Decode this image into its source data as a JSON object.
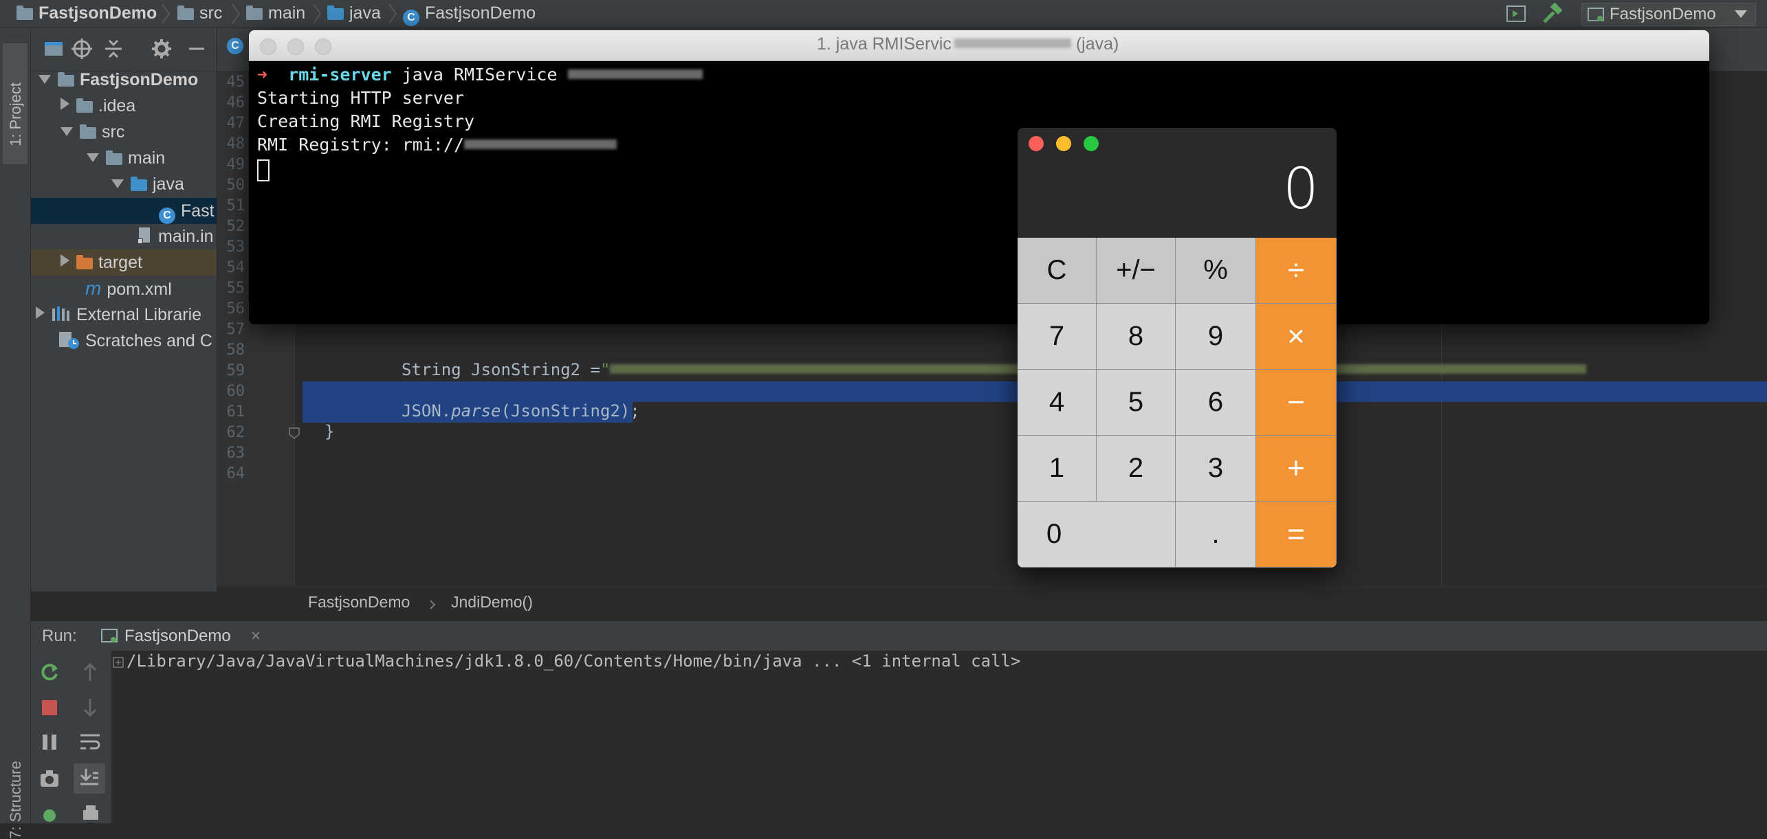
{
  "breadcrumbs": [
    "FastjsonDemo",
    "src",
    "main",
    "java",
    "FastjsonDemo"
  ],
  "run_config": "FastjsonDemo",
  "tool_windows": {
    "project": "1: Project",
    "structure": "7: Structure"
  },
  "project_tree": {
    "root": "FastjsonDemo",
    "idea": ".idea",
    "src": "src",
    "main": "main",
    "java": "java",
    "class_file": "Fast",
    "main_iml": "main.in",
    "target": "target",
    "pom": "pom.xml",
    "pom_icon": "m",
    "external": "External Librarie",
    "scratches": "Scratches and C"
  },
  "editor": {
    "line_numbers": [
      "45",
      "46",
      "47",
      "48",
      "49",
      "50",
      "51",
      "52",
      "53",
      "54",
      "55",
      "56",
      "57",
      "58",
      "59",
      "60",
      "61",
      "62",
      "63",
      "64"
    ],
    "code_59": "String JsonString2 =",
    "code_59_quote": "\"",
    "code_61_obj": "JSON.",
    "code_61_method": "parse",
    "code_61_args": "(JsonString2);",
    "code_62": "}",
    "crumb_class": "FastjsonDemo",
    "crumb_method": "JndiDemo()"
  },
  "run_panel": {
    "label": "Run:",
    "tab": "FastjsonDemo",
    "close": "×",
    "output": "/Library/Java/JavaVirtualMachines/jdk1.8.0_60/Contents/Home/bin/java ... <1 internal call>"
  },
  "terminal": {
    "title": "1. java RMIServic",
    "title_suffix": "(java)",
    "prompt_arrow": "➜",
    "prompt_dir": "rmi-server",
    "command": "java RMIService",
    "line2": "Starting HTTP server",
    "line3": "Creating RMI Registry",
    "line4": "RMI Registry: rmi://"
  },
  "calculator": {
    "display": "0",
    "keys": [
      {
        "label": "C",
        "kind": "fn"
      },
      {
        "label": "+/−",
        "kind": "fn"
      },
      {
        "label": "%",
        "kind": "fn"
      },
      {
        "label": "÷",
        "kind": "op"
      },
      {
        "label": "7",
        "kind": "num"
      },
      {
        "label": "8",
        "kind": "num"
      },
      {
        "label": "9",
        "kind": "num"
      },
      {
        "label": "×",
        "kind": "op"
      },
      {
        "label": "4",
        "kind": "num"
      },
      {
        "label": "5",
        "kind": "num"
      },
      {
        "label": "6",
        "kind": "num"
      },
      {
        "label": "−",
        "kind": "op"
      },
      {
        "label": "1",
        "kind": "num"
      },
      {
        "label": "2",
        "kind": "num"
      },
      {
        "label": "3",
        "kind": "num"
      },
      {
        "label": "+",
        "kind": "op"
      },
      {
        "label": "0",
        "kind": "num"
      },
      {
        "label": ".",
        "kind": "num"
      },
      {
        "label": "=",
        "kind": "op"
      }
    ]
  },
  "colors": {
    "accent_orange": "#f39434",
    "selection": "#214283",
    "terminal_prompt": "#6ad8e8",
    "arrow": "#ff5f57"
  }
}
